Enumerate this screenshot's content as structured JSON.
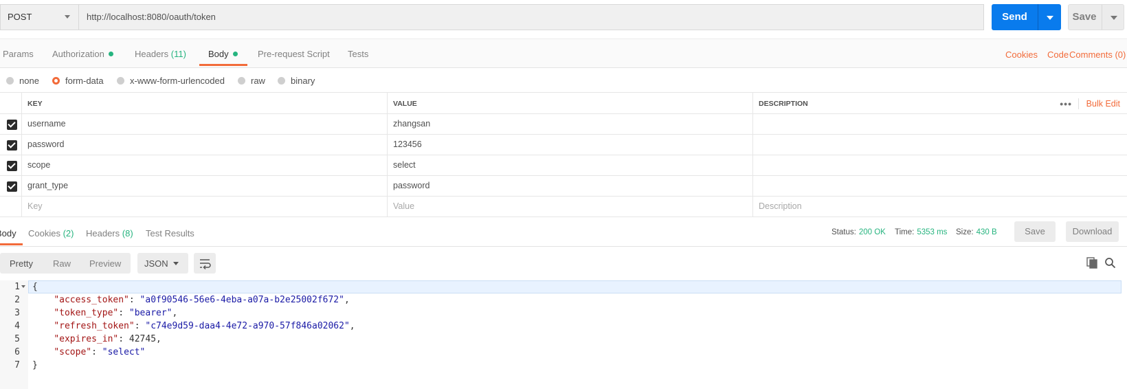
{
  "request": {
    "method": "POST",
    "url": "http://localhost:8080/oauth/token",
    "send_label": "Send",
    "save_label": "Save"
  },
  "request_tabs": [
    {
      "label": "Params"
    },
    {
      "label": "Authorization"
    },
    {
      "label": "Headers",
      "count": "(11)"
    },
    {
      "label": "Body"
    },
    {
      "label": "Pre-request Script"
    },
    {
      "label": "Tests"
    }
  ],
  "right_links": {
    "cookies": "Cookies",
    "code": "Code",
    "comments": "Comments (0)"
  },
  "body_types": [
    "none",
    "form-data",
    "x-www-form-urlencoded",
    "raw",
    "binary"
  ],
  "selected_body_type": "form-data",
  "params_table": {
    "headers": {
      "key": "KEY",
      "value": "VALUE",
      "description": "DESCRIPTION"
    },
    "bulk_edit": "Bulk Edit",
    "more": "•••",
    "rows": [
      {
        "key": "username",
        "value": "zhangsan",
        "checked": true
      },
      {
        "key": "password",
        "value": "123456",
        "checked": true
      },
      {
        "key": "scope",
        "value": "select",
        "checked": true
      },
      {
        "key": "grant_type",
        "value": "password",
        "checked": true
      }
    ],
    "placeholders": {
      "key": "Key",
      "value": "Value",
      "description": "Description"
    }
  },
  "response_tabs": [
    {
      "label": "Body"
    },
    {
      "label": "Cookies",
      "count": "(2)"
    },
    {
      "label": "Headers",
      "count": "(8)"
    },
    {
      "label": "Test Results"
    }
  ],
  "response_status": {
    "status_label": "Status:",
    "status": "200 OK",
    "time_label": "Time:",
    "time": "5353 ms",
    "size_label": "Size:",
    "size": "430 B"
  },
  "response_buttons": {
    "save": "Save",
    "download": "Download"
  },
  "view_modes": [
    "Pretty",
    "Raw",
    "Preview"
  ],
  "format": "JSON",
  "response_body": {
    "line_numbers": [
      "1",
      "2",
      "3",
      "4",
      "5",
      "6",
      "7"
    ],
    "open_brace": "{",
    "close_brace": "}",
    "fields": [
      {
        "key": "\"access_token\"",
        "value": "\"a0f90546-56e6-4eba-a07a-b2e25002f672\"",
        "comma": ","
      },
      {
        "key": "\"token_type\"",
        "value": "\"bearer\"",
        "comma": ","
      },
      {
        "key": "\"refresh_token\"",
        "value": "\"c74e9d59-daa4-4e72-a970-57f846a02062\"",
        "comma": ","
      },
      {
        "key": "\"expires_in\"",
        "value": "42745",
        "comma": ","
      },
      {
        "key": "\"scope\"",
        "value": "\"select\"",
        "comma": ""
      }
    ]
  },
  "colors": {
    "accent": "#f26b3a",
    "send": "#097bed",
    "ok": "#26b47f"
  }
}
